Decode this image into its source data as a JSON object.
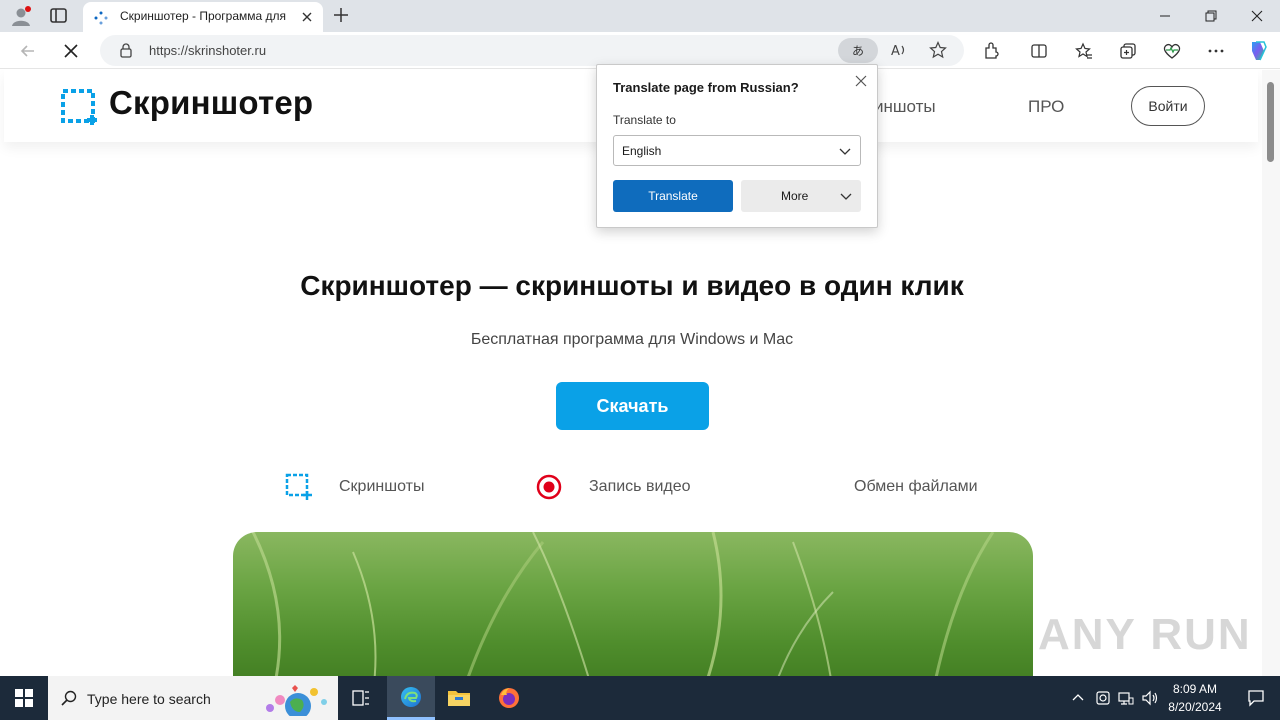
{
  "browser": {
    "tab_title": "Скриншотер - Программа для",
    "url": "https://skrinshoter.ru"
  },
  "site": {
    "logo_text": "Скриншотер",
    "nav_screenshots": "иншоты",
    "nav_pro": "ПРО",
    "login_label": "Войти",
    "hero_title": "Скриншотер — скриншоты и видео в один клик",
    "hero_subtitle": "Бесплатная программа для Windows и Mac",
    "download_label": "Скачать",
    "features": [
      {
        "label": "Скриншоты"
      },
      {
        "label": "Запись видео"
      },
      {
        "label": "Обмен файлами"
      }
    ],
    "watermark": "ANY RUN"
  },
  "translate_popup": {
    "title": "Translate page from Russian?",
    "translate_to_label": "Translate to",
    "selected_language": "English",
    "translate_button": "Translate",
    "more_button": "More"
  },
  "taskbar": {
    "search_placeholder": "Type here to search",
    "time": "8:09 AM",
    "date": "8/20/2024"
  },
  "colors": {
    "accent_blue": "#0aa1e7",
    "translate_btn": "#0f6cbd",
    "record_red": "#e0001a",
    "logo_blue": "#0aa1e7"
  }
}
